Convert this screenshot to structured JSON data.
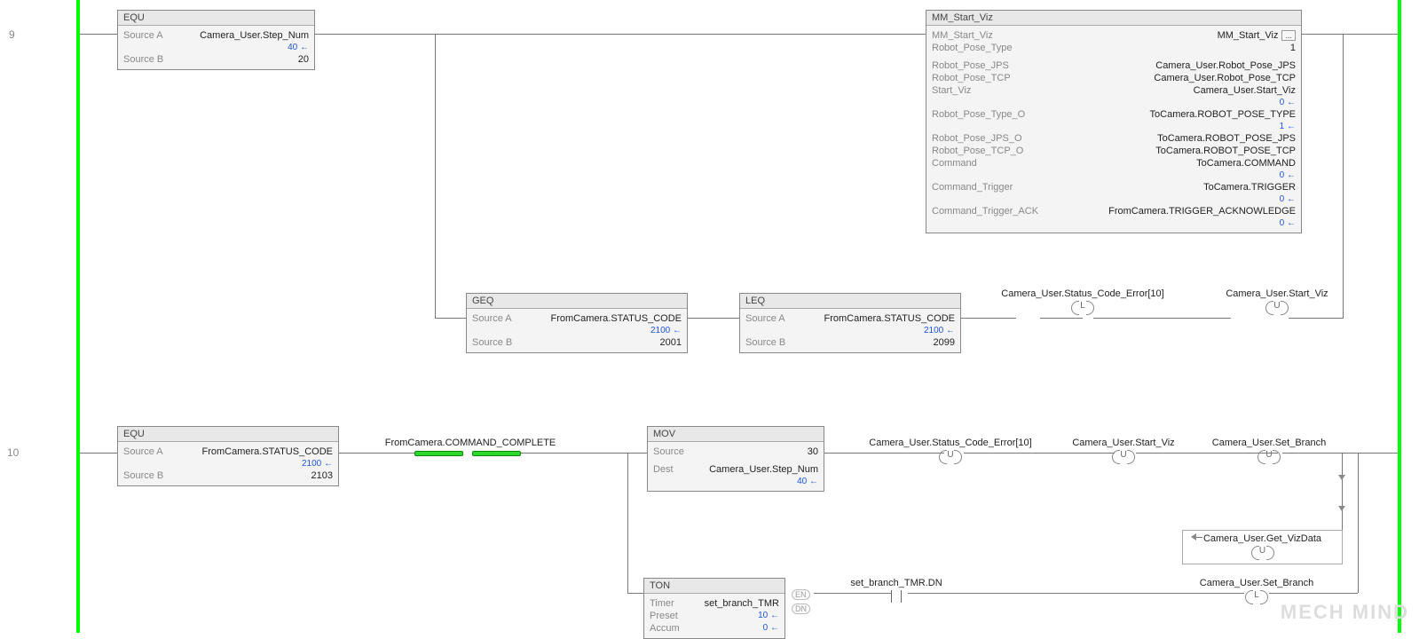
{
  "rungs": {
    "r1": "9",
    "r2": "10"
  },
  "equ1": {
    "title": "EQU",
    "sourceA_lbl": "Source A",
    "sourceA_val": "Camera_User.Step_Num",
    "sourceA_live": "40 ←",
    "sourceB_lbl": "Source B",
    "sourceB_val": "20"
  },
  "mmStart": {
    "title": "MM_Start_Viz",
    "row1_lbl": "MM_Start_Viz",
    "row1_val": "MM_Start_Viz",
    "row2_lbl": "Robot_Pose_Type",
    "row2_val": "1",
    "row3_lbl": "Robot_Pose_JPS",
    "row3_val": "Camera_User.Robot_Pose_JPS",
    "row4_lbl": "Robot_Pose_TCP",
    "row4_val": "Camera_User.Robot_Pose_TCP",
    "row5_lbl": "Start_Viz",
    "row5_val": "Camera_User.Start_Viz",
    "row5_live": "0 ←",
    "row6_lbl": "Robot_Pose_Type_O",
    "row6_val": "ToCamera.ROBOT_POSE_TYPE",
    "row6_live": "1 ←",
    "row7_lbl": "Robot_Pose_JPS_O",
    "row7_val": "ToCamera.ROBOT_POSE_JPS",
    "row8_lbl": "Robot_Pose_TCP_O",
    "row8_val": "ToCamera.ROBOT_POSE_TCP",
    "row9_lbl": "Command",
    "row9_val": "ToCamera.COMMAND",
    "row9_live": "0 ←",
    "row10_lbl": "Command_Trigger",
    "row10_val": "ToCamera.TRIGGER",
    "row10_live": "0 ←",
    "row11_lbl": "Command_Trigger_ACK",
    "row11_val": "FromCamera.TRIGGER_ACKNOWLEDGE",
    "row11_live": "0 ←"
  },
  "geq": {
    "title": "GEQ",
    "sourceA_lbl": "Source A",
    "sourceA_val": "FromCamera.STATUS_CODE",
    "sourceA_live": "2100 ←",
    "sourceB_lbl": "Source B",
    "sourceB_val": "2001"
  },
  "leq": {
    "title": "LEQ",
    "sourceA_lbl": "Source A",
    "sourceA_val": "FromCamera.STATUS_CODE",
    "sourceA_live": "2100 ←",
    "sourceB_lbl": "Source B",
    "sourceB_val": "2099"
  },
  "coil1": {
    "label": "Camera_User.Status_Code_Error[10]",
    "type": "L"
  },
  "coil2": {
    "label": "Camera_User.Start_Viz",
    "type": "U"
  },
  "equ2": {
    "title": "EQU",
    "sourceA_lbl": "Source A",
    "sourceA_val": "FromCamera.STATUS_CODE",
    "sourceA_live": "2100 ←",
    "sourceB_lbl": "Source B",
    "sourceB_val": "2103"
  },
  "xic1": {
    "label": "FromCamera.COMMAND_COMPLETE"
  },
  "mov": {
    "title": "MOV",
    "source_lbl": "Source",
    "source_val": "30",
    "dest_lbl": "Dest",
    "dest_val": "Camera_User.Step_Num",
    "dest_live": "40 ←"
  },
  "coil3": {
    "label": "Camera_User.Status_Code_Error[10]",
    "type": "U"
  },
  "coil4": {
    "label": "Camera_User.Start_Viz",
    "type": "U"
  },
  "coil5": {
    "label": "Camera_User.Set_Branch",
    "type": "U"
  },
  "coil6": {
    "label": "Camera_User.Get_VizData",
    "type": "U"
  },
  "ton": {
    "title": "TON",
    "timer_lbl": "Timer",
    "timer_val": "set_branch_TMR",
    "preset_lbl": "Preset",
    "preset_val": "10 ←",
    "accum_lbl": "Accum",
    "accum_val": "0 ←",
    "en": "EN",
    "dn": "DN"
  },
  "xic2": {
    "label": "set_branch_TMR.DN"
  },
  "coil7": {
    "label": "Camera_User.Set_Branch",
    "type": "L"
  },
  "watermark": "MECH MIND"
}
